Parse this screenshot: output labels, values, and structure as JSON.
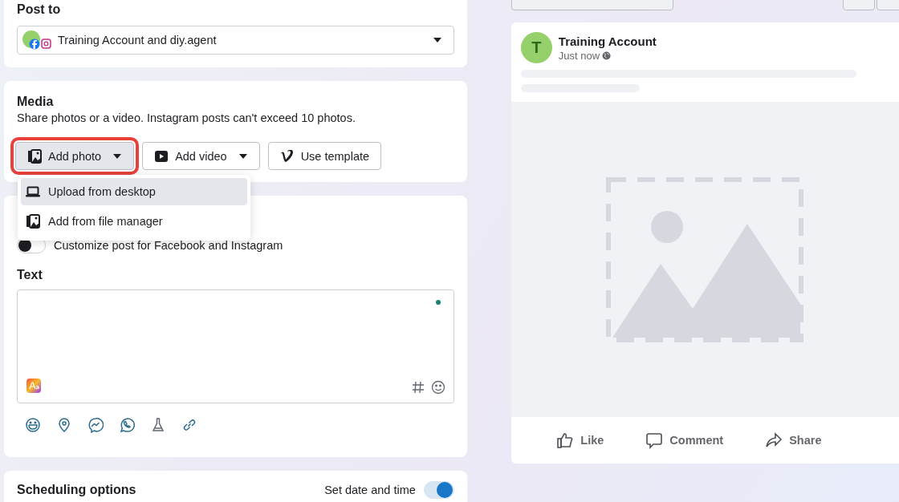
{
  "post_to": {
    "heading": "Post to",
    "account": "Training Account and diy.agent"
  },
  "media": {
    "heading": "Media",
    "description": "Share photos or a video. Instagram posts can't exceed 10 photos.",
    "buttons": [
      {
        "label": "Add photo",
        "kind": "photo",
        "dropdown": true,
        "highlighted": true
      },
      {
        "label": "Add video",
        "kind": "video",
        "dropdown": true,
        "highlighted": false
      },
      {
        "label": "Use template",
        "kind": "template",
        "dropdown": false,
        "highlighted": false
      }
    ],
    "menu": [
      {
        "label": "Upload from desktop",
        "kind": "desktop",
        "selected": true
      },
      {
        "label": "Add from file manager",
        "kind": "files",
        "selected": false
      }
    ]
  },
  "customize": {
    "label": "Customize post for Facebook and Instagram",
    "on": false
  },
  "text": {
    "heading": "Text"
  },
  "scheduling": {
    "heading": "Scheduling options",
    "toggle_label": "Set date and time",
    "on": true
  },
  "preview": {
    "initial": "T",
    "name": "Training Account",
    "time": "Just now",
    "actions": [
      {
        "label": "Like",
        "kind": "like"
      },
      {
        "label": "Comment",
        "kind": "comment"
      },
      {
        "label": "Share",
        "kind": "share"
      }
    ]
  }
}
